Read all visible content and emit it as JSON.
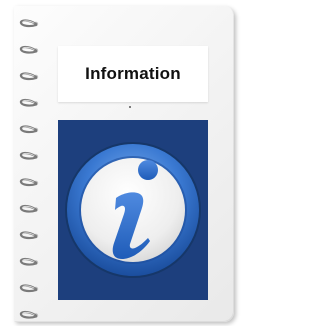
{
  "title": "Information",
  "icon": "info-icon",
  "colors": {
    "panel": "#1d3f7d",
    "icon_blue": "#2e6bc6",
    "icon_face": "#f2f2f2",
    "title_text": "#111111"
  }
}
